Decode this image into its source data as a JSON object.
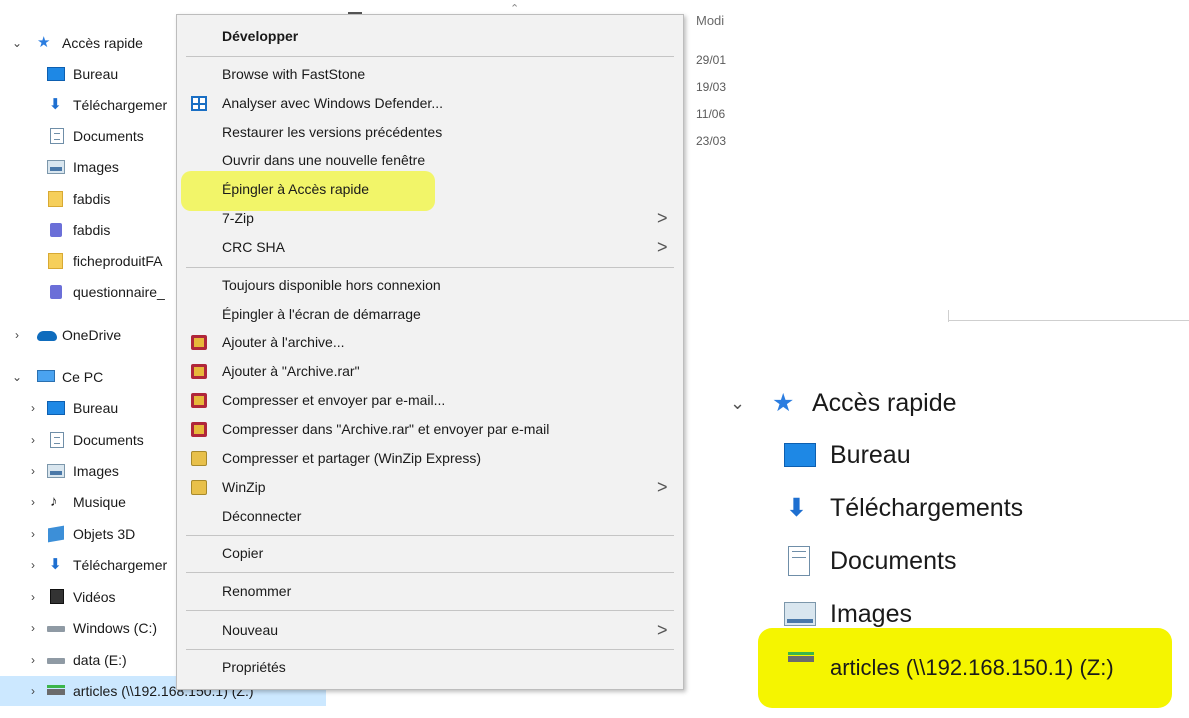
{
  "nav": {
    "items": [
      {
        "label": "Accès rapide",
        "icon": "star-icon",
        "chevron": "v"
      },
      {
        "label": "Bureau",
        "icon": "desktop-icon"
      },
      {
        "label": "Téléchargemer",
        "icon": "download-icon"
      },
      {
        "label": "Documents",
        "icon": "documents-icon"
      },
      {
        "label": "Images",
        "icon": "images-icon"
      },
      {
        "label": "fabdis",
        "icon": "folder-icon"
      },
      {
        "label": "fabdis",
        "icon": "pdf-icon"
      },
      {
        "label": "ficheproduitFA",
        "icon": "folder-icon"
      },
      {
        "label": "questionnaire_",
        "icon": "pdf-icon"
      },
      {
        "label": "OneDrive",
        "icon": "onedrive-icon",
        "chevron": ">"
      },
      {
        "label": "Ce PC",
        "icon": "pc-icon",
        "chevron": "v"
      },
      {
        "label": "Bureau",
        "icon": "desktop-icon",
        "chevron": ">"
      },
      {
        "label": "Documents",
        "icon": "documents-icon",
        "chevron": ">"
      },
      {
        "label": "Images",
        "icon": "images-icon",
        "chevron": ">"
      },
      {
        "label": "Musique",
        "icon": "music-icon",
        "chevron": ">"
      },
      {
        "label": "Objets 3D",
        "icon": "objects-3d-icon",
        "chevron": ">"
      },
      {
        "label": "Téléchargemer",
        "icon": "download-icon",
        "chevron": ">"
      },
      {
        "label": "Vidéos",
        "icon": "videos-icon",
        "chevron": ">"
      },
      {
        "label": "Windows (C:)",
        "icon": "drive-icon",
        "chevron": ">"
      },
      {
        "label": "data (E:)",
        "icon": "drive-icon",
        "chevron": ">"
      },
      {
        "label": "articles (\\\\192.168.150.1) (Z:)",
        "icon": "network-drive-icon",
        "chevron": ">"
      }
    ]
  },
  "details": {
    "column_header": "Modi",
    "dates": [
      "29/01",
      "19/03",
      "11/06",
      "23/03"
    ]
  },
  "menu": {
    "items": [
      {
        "label": "Développer",
        "bold": true
      },
      {
        "label": "Browse with FastStone"
      },
      {
        "label": "Analyser avec Windows Defender...",
        "icon": "windows-defender-icon"
      },
      {
        "label": "Restaurer les versions précédentes"
      },
      {
        "label": "Ouvrir dans une nouvelle fenêtre"
      },
      {
        "label": "Épingler à Accès rapide",
        "highlighted": true
      },
      {
        "label": "7-Zip",
        "submenu": ">"
      },
      {
        "label": "CRC SHA",
        "submenu": ">"
      },
      {
        "label": "Toujours disponible hors connexion"
      },
      {
        "label": "Épingler à l'écran de démarrage"
      },
      {
        "label": "Ajouter à l'archive...",
        "icon": "winrar-icon"
      },
      {
        "label": "Ajouter à \"Archive.rar\"",
        "icon": "winrar-icon"
      },
      {
        "label": "Compresser et envoyer par e-mail...",
        "icon": "winrar-icon"
      },
      {
        "label": "Compresser dans \"Archive.rar\" et envoyer par e-mail",
        "icon": "winrar-icon"
      },
      {
        "label": "Compresser et partager (WinZip Express)",
        "icon": "winzip-icon"
      },
      {
        "label": "WinZip",
        "icon": "winzip-icon",
        "submenu": ">"
      },
      {
        "label": "Déconnecter"
      },
      {
        "label": "Copier"
      },
      {
        "label": "Renommer"
      },
      {
        "label": "Nouveau",
        "submenu": ">"
      },
      {
        "label": "Propriétés"
      }
    ],
    "highlight_color": "#f2f55a"
  },
  "inset": {
    "items": [
      {
        "label": "Accès rapide",
        "icon": "star-icon",
        "chevron": "v"
      },
      {
        "label": "Bureau",
        "icon": "desktop-icon"
      },
      {
        "label": "Téléchargements",
        "icon": "download-icon"
      },
      {
        "label": "Documents",
        "icon": "documents-icon"
      },
      {
        "label": "Images",
        "icon": "images-icon"
      },
      {
        "label": "articles (\\\\192.168.150.1) (Z:)",
        "icon": "network-drive-icon",
        "highlighted": true
      }
    ],
    "highlight_color": "#f5f500"
  },
  "colors": {
    "selection": "#cce8ff",
    "accent_blue": "#1e88e5",
    "menu_bg": "#f2f2f2"
  }
}
